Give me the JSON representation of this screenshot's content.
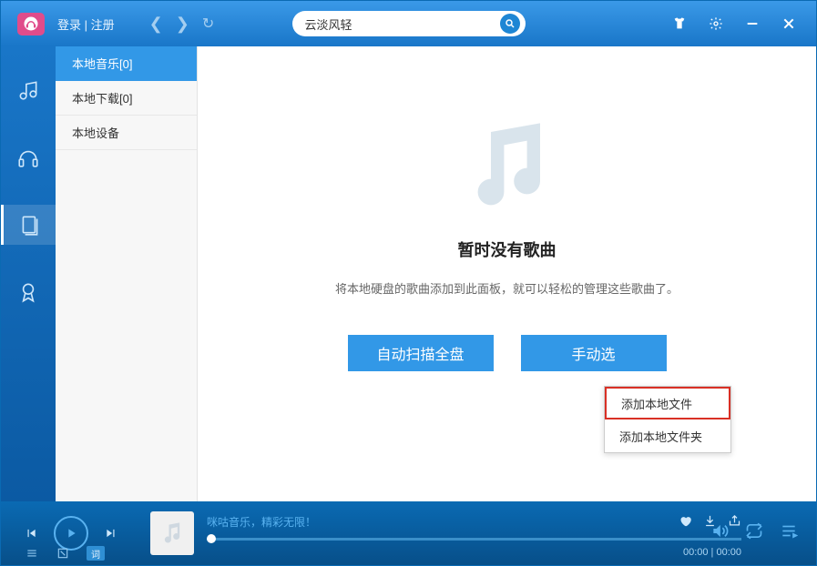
{
  "topbar": {
    "login": "登录",
    "divider": " | ",
    "register": "注册",
    "search_value": "云淡风轻"
  },
  "sidebar": {
    "items": [
      {
        "label": "本地音乐[0]"
      },
      {
        "label": "本地下载[0]"
      },
      {
        "label": "本地设备"
      }
    ]
  },
  "main": {
    "empty_title": "暂时没有歌曲",
    "empty_desc": "将本地硬盘的歌曲添加到此面板，就可以轻松的管理这些歌曲了。",
    "btn_scan": "自动扫描全盘",
    "btn_manual": "手动选",
    "menu": {
      "add_file": "添加本地文件",
      "add_folder": "添加本地文件夹"
    }
  },
  "player": {
    "now_playing": "咪咕音乐，精彩无限！",
    "time_current": "00:00",
    "time_total": "00:00",
    "lyric_label": "词"
  }
}
